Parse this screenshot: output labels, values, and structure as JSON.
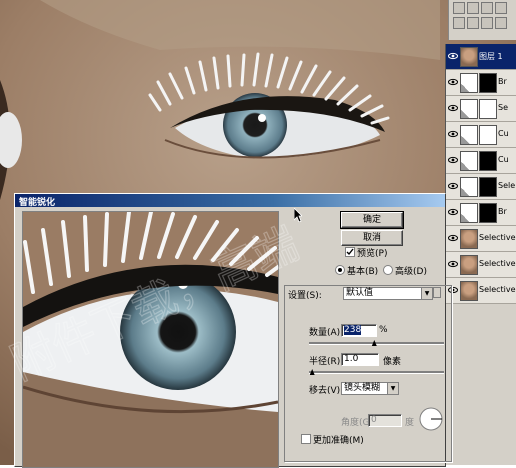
{
  "dialog": {
    "title": "智能锐化",
    "ok_label": "确定",
    "cancel_label": "取消",
    "preview_label": "预览(P)",
    "preview_checked": true,
    "mode_basic_label": "基本(B)",
    "mode_advanced_label": "高级(D)",
    "settings_label": "设置(S):",
    "settings_value": "默认值",
    "amount_label": "数量(A):",
    "amount_value": "238",
    "amount_unit": "%",
    "amount_fraction": 0.48,
    "radius_label": "半径(R):",
    "radius_value": "1.0",
    "radius_unit": "像素",
    "radius_fraction": 0.02,
    "remove_label": "移去(V):",
    "remove_value": "镜头模糊",
    "angle_label": "角度(G):",
    "angle_value": "0",
    "angle_unit": "度",
    "more_accurate_label": "更加准确(M)",
    "more_accurate_checked": false
  },
  "layers": [
    {
      "name": "图层 1",
      "selected": true,
      "thumb": "portrait"
    },
    {
      "name": "Br",
      "selected": false,
      "thumb": "mask-black"
    },
    {
      "name": "Se",
      "selected": false,
      "thumb": "mask-white"
    },
    {
      "name": "Cu",
      "selected": false,
      "thumb": "mask-white"
    },
    {
      "name": "Cu",
      "selected": false,
      "thumb": "mask-black"
    },
    {
      "name": "Sele",
      "selected": false,
      "thumb": "mask-black"
    },
    {
      "name": "Br",
      "selected": false,
      "thumb": "mask-black"
    },
    {
      "name": "Selective Co",
      "selected": false,
      "thumb": "portrait"
    },
    {
      "name": "Selective Co",
      "selected": false,
      "thumb": "portrait"
    },
    {
      "name": "Selective Co",
      "selected": false,
      "thumb": "portrait"
    }
  ],
  "watermark": "附件下载，高端",
  "colors": {
    "titlebar": "#0a246a",
    "dialog_bg": "#d4d0c8",
    "skin": "#a88a70",
    "iris": "#6f8f9e"
  }
}
